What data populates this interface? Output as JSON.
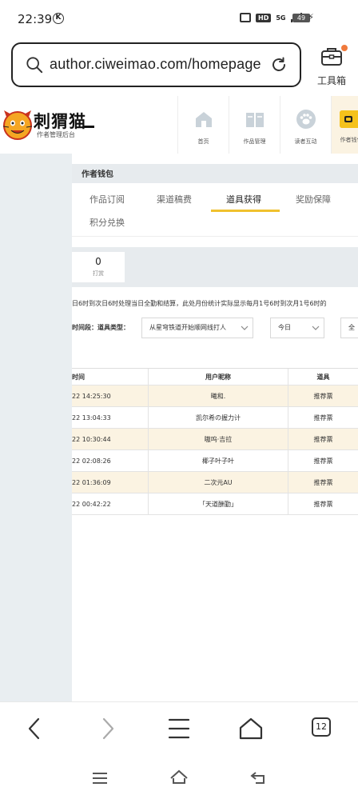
{
  "status_bar": {
    "time": "22:39",
    "k_badge": "K",
    "hd": "HD",
    "network": "5G",
    "battery": "49"
  },
  "url_bar": {
    "url": "author.ciweimao.com/homepage",
    "toolbox_label": "工具箱"
  },
  "site": {
    "logo_title": "刺猬猫",
    "logo_subtitle": "作者管理后台",
    "nav": [
      {
        "label": "首页",
        "icon": "home-icon"
      },
      {
        "label": "作品管理",
        "icon": "book-icon"
      },
      {
        "label": "读者互动",
        "icon": "paw-icon"
      },
      {
        "label": "作者钱包",
        "icon": "wallet-icon"
      }
    ]
  },
  "wallet": {
    "title": "作者钱包",
    "tabs": [
      "作品订阅",
      "渠道稿费",
      "道具获得",
      "奖励保障",
      "积分兑换"
    ],
    "active_tab": "道具获得",
    "stat": {
      "value": "0",
      "label": "打赏"
    },
    "notice": "日6时到次日6时处理当日全勤和结算，此处月份统计实际显示每月1号6时到次月1号6时的",
    "filter_label": "时间段：道具类型：",
    "work_select": "从星穹铁道开始顺网线打人",
    "date_select": "今日",
    "type_select": "全"
  },
  "table": {
    "headers": [
      "时间",
      "用户昵称",
      "道具"
    ],
    "rows": [
      {
        "time": "22 14:25:30",
        "user": "曦和.",
        "item": "推荐票"
      },
      {
        "time": "22 13:04:33",
        "user": "凯尔希の握力计",
        "item": "推荐票"
      },
      {
        "time": "22 10:30:44",
        "user": "嗷呜·吉拉",
        "item": "推荐票"
      },
      {
        "time": "22 02:08:26",
        "user": "椰子叶子叶",
        "item": "推荐票"
      },
      {
        "time": "22 01:36:09",
        "user": "二次元AU",
        "item": "推荐票"
      },
      {
        "time": "22 00:42:22",
        "user": "「天道酬勤」",
        "item": "推荐票"
      }
    ]
  },
  "bottom_bar": {
    "tabs_count": "12"
  },
  "colors": {
    "accent": "#f5c21b",
    "row_highlight": "#fbf3e2",
    "panel_gray": "#e7ebee",
    "dot": "#f07a3c"
  }
}
